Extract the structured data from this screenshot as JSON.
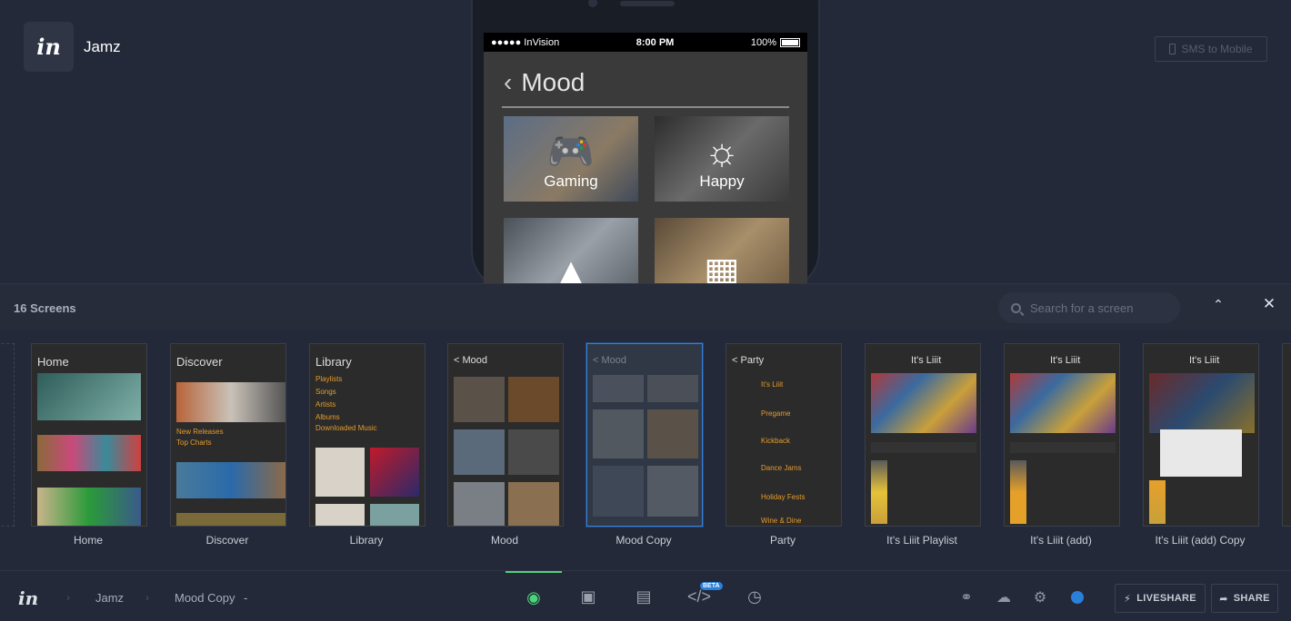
{
  "project": {
    "name": "Jamz",
    "logo_text": "in"
  },
  "sms_button": {
    "label": "SMS to Mobile"
  },
  "phone": {
    "status": {
      "carrier": "●●●●● InVision",
      "time": "8:00 PM",
      "battery": "100%"
    },
    "screen_title": "Mood",
    "tiles": [
      {
        "label": "Gaming",
        "icon": "gamepad-icon"
      },
      {
        "label": "Happy",
        "icon": "sun-icon"
      },
      {
        "label": "",
        "icon": "tree-icon"
      },
      {
        "label": "",
        "icon": "piano-icon"
      }
    ]
  },
  "panel": {
    "count_label": "16 Screens",
    "search_placeholder": "Search for a screen",
    "collapse_icon": "chevron-up-icon",
    "close_icon": "close-icon"
  },
  "screens": [
    {
      "label": "Home",
      "title": "Home",
      "selected": false
    },
    {
      "label": "Discover",
      "title": "Discover",
      "selected": false
    },
    {
      "label": "Library",
      "title": "Library",
      "selected": false
    },
    {
      "label": "Mood",
      "title": "< Mood",
      "selected": false
    },
    {
      "label": "Mood Copy",
      "title": "< Mood",
      "selected": true
    },
    {
      "label": "Party",
      "title": "< Party",
      "selected": false
    },
    {
      "label": "It's Liiit Playlist",
      "title": "It's Liiit",
      "selected": false
    },
    {
      "label": "It's Liiit (add)",
      "title": "It's Liiit",
      "selected": false
    },
    {
      "label": "It's Liiit (add) Copy",
      "title": "It's Liiit",
      "selected": false
    }
  ],
  "toolbar": {
    "logo_text": "in",
    "crumb_project": "Jamz",
    "crumb_screen": "Mood Copy",
    "crumb_caret": "-",
    "beta_badge": "BETA",
    "liveshare_label": "LIVESHARE",
    "share_label": "SHARE"
  }
}
